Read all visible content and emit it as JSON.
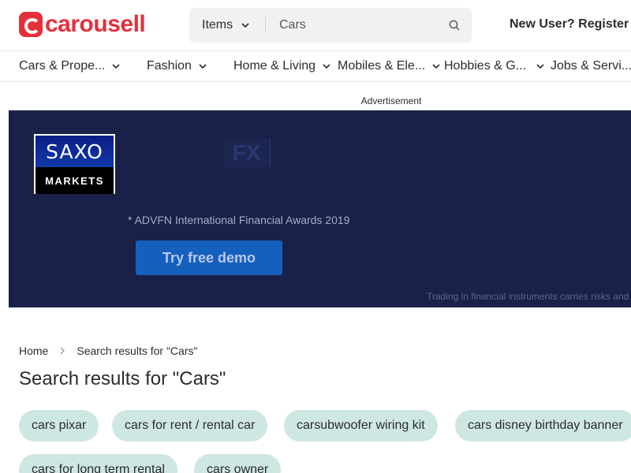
{
  "header": {
    "logo_text": "carousell",
    "search": {
      "category_label": "Items",
      "query": "Cars"
    },
    "register_label": "New User? Register"
  },
  "categories": [
    "Cars & Prope...",
    "Fashion",
    "Home & Living",
    "Mobiles & Ele...",
    "Hobbies & G...",
    "Jobs & Servi..."
  ],
  "ad": {
    "label": "Advertisement",
    "brand_top": "SAXO",
    "brand_bottom": "MARKETS",
    "fx_text": "FX",
    "award_text": "* ADVFN International Financial Awards 2019",
    "cta_label": "Try free demo",
    "disclaimer": "Trading in financial instruments carries risks and"
  },
  "breadcrumb": {
    "home": "Home",
    "current": "Search results for \"Cars\""
  },
  "page_title": "Search results for \"Cars\"",
  "suggestions": [
    "cars pixar",
    "cars for rent / rental car",
    "carsubwoofer wiring kit",
    "cars disney birthday banner",
    "cars for long term rental",
    "cars owner"
  ],
  "colors": {
    "brand": "#e5303a",
    "chip": "#cfe7e3",
    "ad_bg": "#1a2148",
    "cta": "#1560bd"
  }
}
